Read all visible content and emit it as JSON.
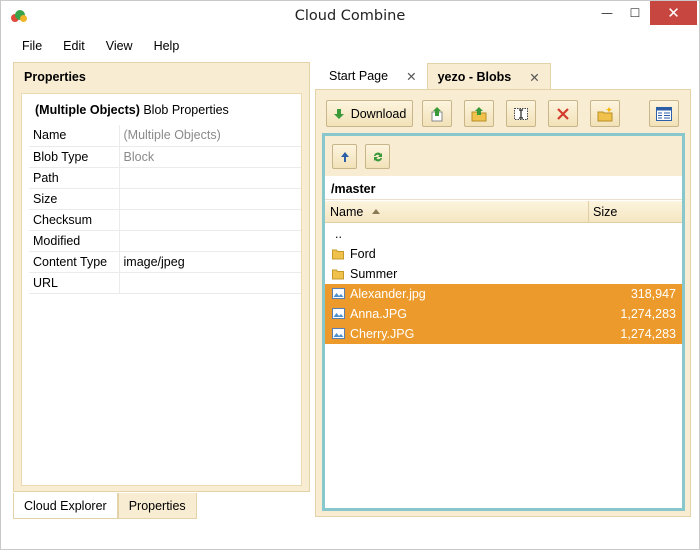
{
  "window": {
    "title": "Cloud Combine",
    "min_glyph": "—",
    "max_glyph": "☐",
    "close_glyph": "✕"
  },
  "menu": [
    "File",
    "Edit",
    "View",
    "Help"
  ],
  "left": {
    "header": "Properties",
    "object_bold": "(Multiple Objects)",
    "object_suffix": " Blob Properties",
    "properties": [
      {
        "key": "Name",
        "value": "(Multiple Objects)",
        "muted": true
      },
      {
        "key": "Blob Type",
        "value": "Block",
        "muted": true
      },
      {
        "key": "Path",
        "value": ""
      },
      {
        "key": "Size",
        "value": ""
      },
      {
        "key": "Checksum",
        "value": ""
      },
      {
        "key": "Modified",
        "value": ""
      },
      {
        "key": "Content Type",
        "value": "image/jpeg"
      },
      {
        "key": "URL",
        "value": ""
      }
    ],
    "bottom_tabs": [
      "Cloud Explorer",
      "Properties"
    ]
  },
  "tabs": [
    {
      "label": "Start Page",
      "active": false,
      "close": "✕"
    },
    {
      "label": "yezo - Blobs",
      "active": true,
      "close": "✕"
    }
  ],
  "toolbar": {
    "download_label": "Download"
  },
  "browser": {
    "path": "/master",
    "col_name": "Name",
    "col_size": "Size",
    "up_label": "..",
    "folders": [
      "Ford",
      "Summer"
    ],
    "files": [
      {
        "name": "Alexander.jpg",
        "size": "318,947"
      },
      {
        "name": "Anna.JPG",
        "size": "1,274,283"
      },
      {
        "name": "Cherry.JPG",
        "size": "1,274,283"
      }
    ]
  },
  "colors": {
    "accent": "#ec9a2b",
    "panel": "#f8ecd2",
    "frame": "#88c8cc",
    "close": "#c7463f"
  }
}
